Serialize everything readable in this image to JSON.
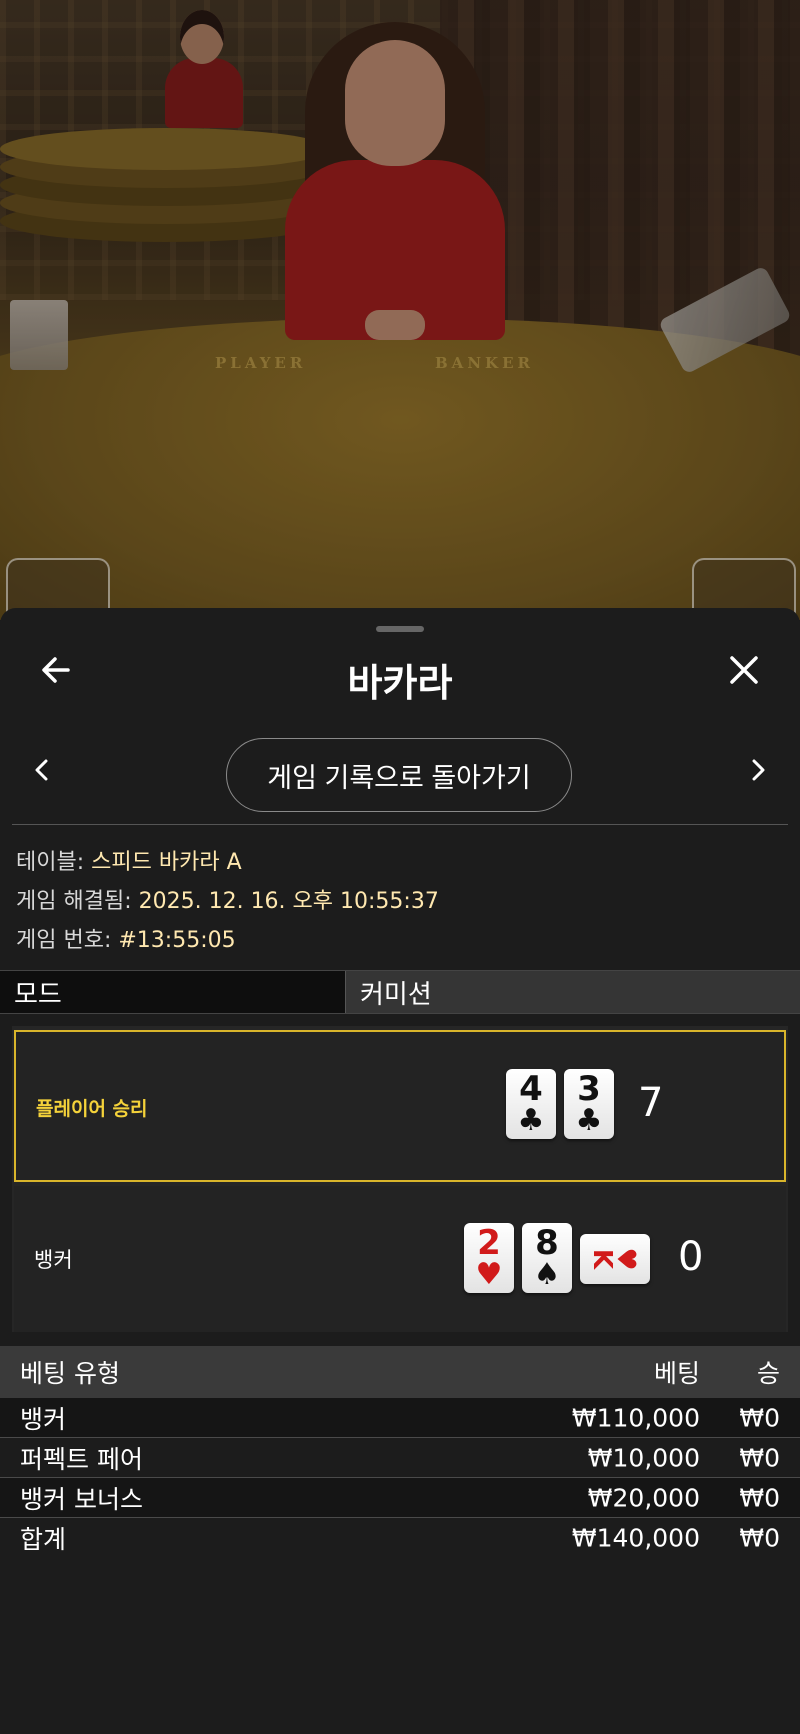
{
  "video": {
    "table_labels": {
      "player": "PLAYER",
      "banker": "BANKER"
    }
  },
  "header": {
    "title": "바카라",
    "back_icon": "arrow-left-icon",
    "close_icon": "close-icon"
  },
  "nav": {
    "back_to_history": "게임 기록으로 돌아가기",
    "prev_icon": "chevron-left-icon",
    "next_icon": "chevron-right-icon"
  },
  "info": {
    "table_label": "테이블: ",
    "table_value": "스피드 바카라 A",
    "resolved_label": "게임 해결됨: ",
    "resolved_value": "2025. 12. 16. 오후 10:55:37",
    "number_label": "게임 번호: ",
    "number_value": "#13:55:05"
  },
  "mode": {
    "label": "모드",
    "value": "커미션"
  },
  "result": {
    "player": {
      "label": "플레이어 승리",
      "cards": [
        {
          "rank": "4",
          "suit": "♣",
          "color": "black"
        },
        {
          "rank": "3",
          "suit": "♣",
          "color": "black"
        }
      ],
      "score": "7"
    },
    "banker": {
      "label": "뱅커",
      "cards": [
        {
          "rank": "2",
          "suit": "♥",
          "color": "red"
        },
        {
          "rank": "8",
          "suit": "♠",
          "color": "black"
        },
        {
          "rank": "K",
          "suit": "♥",
          "color": "red",
          "orientation": "sideways"
        }
      ],
      "score": "0"
    },
    "winner_color": "#d9b52b"
  },
  "bets": {
    "headers": {
      "type": "베팅 유형",
      "bet": "베팅",
      "win": "승"
    },
    "rows": [
      {
        "type": "뱅커",
        "bet": "₩110,000",
        "win": "₩0"
      },
      {
        "type": "퍼펙트 페어",
        "bet": "₩10,000",
        "win": "₩0"
      },
      {
        "type": "뱅커 보너스",
        "bet": "₩20,000",
        "win": "₩0"
      },
      {
        "type": "합계",
        "bet": "₩140,000",
        "win": "₩0"
      }
    ]
  }
}
